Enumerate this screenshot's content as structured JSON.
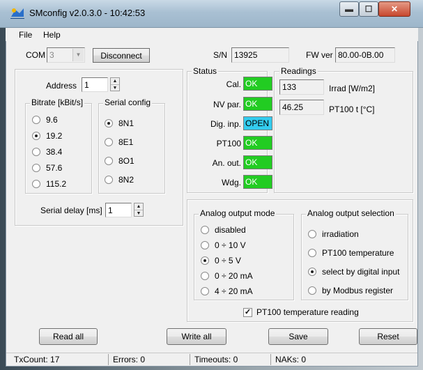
{
  "window": {
    "title": "SMconfig v2.0.3.0 - 10:42:53",
    "controls": [
      "minimize",
      "maximize",
      "close"
    ]
  },
  "menu": {
    "file": "File",
    "help": "Help"
  },
  "connection": {
    "com_label": "COM",
    "com_value": "3",
    "disconnect_label": "Disconnect",
    "sn_label": "S/N",
    "sn_value": "13925",
    "fw_label": "FW ver",
    "fw_value": "80.00-0B.00"
  },
  "settings": {
    "address_label": "Address",
    "address_value": "1",
    "bitrate": {
      "title": "Bitrate [kBit/s]",
      "options": [
        "9.6",
        "19.2",
        "38.4",
        "57.6",
        "115.2"
      ],
      "selected": "19.2"
    },
    "serial_config": {
      "title": "Serial config",
      "options": [
        "8N1",
        "8E1",
        "8O1",
        "8N2"
      ],
      "selected": "8N1"
    },
    "serial_delay_label": "Serial delay [ms]",
    "serial_delay_value": "1"
  },
  "status": {
    "title": "Status",
    "items": [
      {
        "label": "Cal.",
        "value": "OK",
        "color": "#22cc22"
      },
      {
        "label": "NV par.",
        "value": "OK",
        "color": "#22cc22"
      },
      {
        "label": "Dig. inp.",
        "value": "OPEN",
        "color": "#33ccee"
      },
      {
        "label": "PT100",
        "value": "OK",
        "color": "#22cc22"
      },
      {
        "label": "An. out.",
        "value": "OK",
        "color": "#22cc22"
      },
      {
        "label": "Wdg.",
        "value": "OK",
        "color": "#22cc22"
      }
    ]
  },
  "readings": {
    "title": "Readings",
    "irrad_value": "133",
    "irrad_label": "Irrad [W/m2]",
    "temp_value": "46.25",
    "temp_label": "PT100 t [°C]"
  },
  "analog_mode": {
    "title": "Analog output mode",
    "options": [
      "disabled",
      "0 ÷ 10 V",
      "0 ÷ 5 V",
      "0 ÷ 20 mA",
      "4 ÷ 20 mA"
    ],
    "selected": "0 ÷ 5 V"
  },
  "analog_selection": {
    "title": "Analog output selection",
    "options": [
      "irradiation",
      "PT100 temperature",
      "select by digital input",
      "by Modbus register"
    ],
    "selected": "select by digital input"
  },
  "pt100_reading": {
    "label": "PT100 temperature reading",
    "checked": true,
    "check_glyph": "✓"
  },
  "actions": {
    "read_all": "Read all",
    "write_all": "Write all",
    "save": "Save",
    "reset": "Reset"
  },
  "statusbar": {
    "txcount": "TxCount: 17",
    "errors": "Errors: 0",
    "timeouts": "Timeouts: 0",
    "naks": "NAKs: 0"
  }
}
